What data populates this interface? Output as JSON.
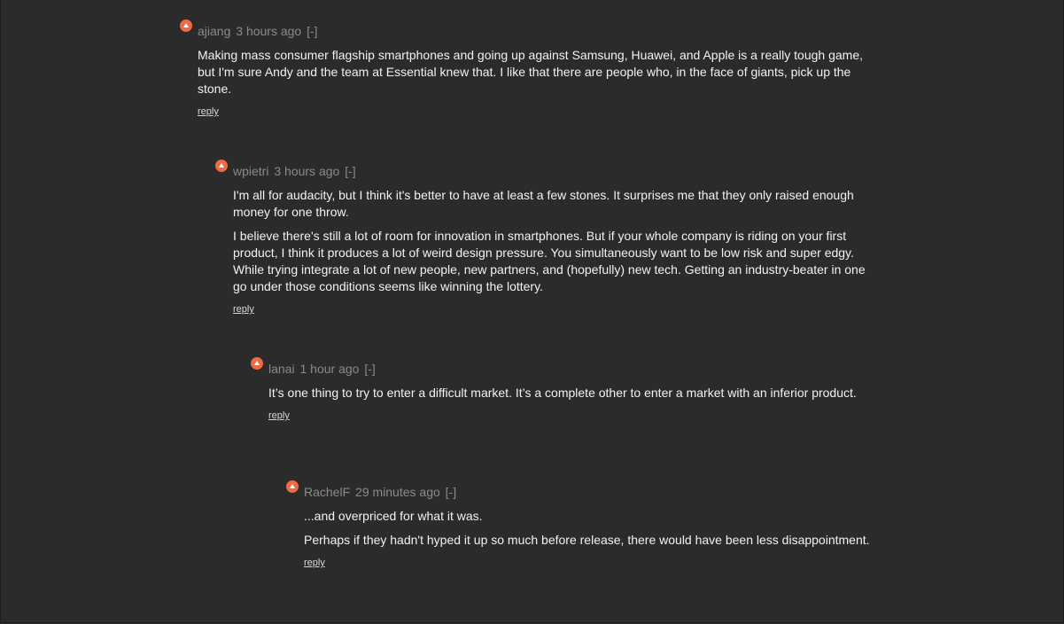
{
  "comments": [
    {
      "user": "ajiang",
      "age": "3 hours ago",
      "toggle": "[-]",
      "paragraphs": [
        "Making mass consumer flagship smartphones and going up against Samsung, Huawei, and Apple is a really tough game, but I'm sure Andy and the team at Essential knew that. I like that there are people who, in the face of giants, pick up the stone."
      ],
      "reply": "reply"
    },
    {
      "user": "wpietri",
      "age": "3 hours ago",
      "toggle": "[-]",
      "paragraphs": [
        "I'm all for audacity, but I think it's better to have at least a few stones. It surprises me that they only raised enough money for one throw.",
        "I believe there's still a lot of room for innovation in smartphones. But if your whole company is riding on your first product, I think it produces a lot of weird design pressure. You simultaneously want to be low risk and super edgy. While trying integrate a lot of new people, new partners, and (hopefully) new tech. Getting an industry-beater in one go under those conditions seems like winning the lottery."
      ],
      "reply": "reply"
    },
    {
      "user": "lanai",
      "age": "1 hour ago",
      "toggle": "[-]",
      "paragraphs": [
        "It’s one thing to try to enter a difficult market. It’s a complete other to enter a market with an inferior product."
      ],
      "reply": "reply"
    },
    {
      "user": "RachelF",
      "age": "29 minutes ago",
      "toggle": "[-]",
      "paragraphs": [
        "...and overpriced for what it was.",
        "Perhaps if they hadn't hyped it up so much before release, there would have been less disappointment."
      ],
      "reply": "reply"
    }
  ],
  "colors": {
    "background": "#2b2b2b",
    "upvote": "#ee6a43",
    "meta_text": "#8a8a8a",
    "body_text": "#f2f2f2"
  },
  "icons": {
    "upvote": "upvote-arrow-icon"
  }
}
